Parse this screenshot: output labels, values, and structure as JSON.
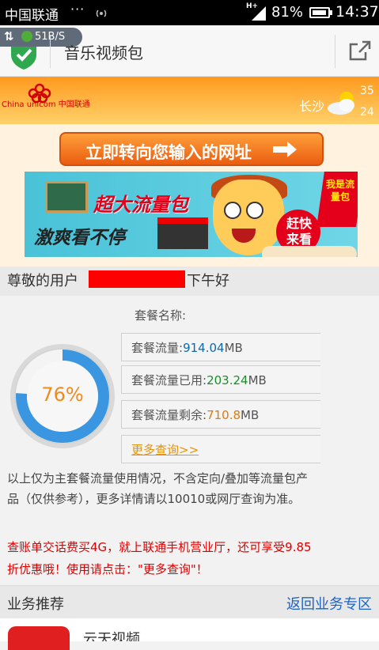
{
  "status_bar": {
    "carrier": "中国联通",
    "dots": "···",
    "network": "H+",
    "battery": "81%",
    "time": "14:37"
  },
  "title_bar": {
    "speed": "51B/S",
    "title": "音乐视频包"
  },
  "header": {
    "logo_en": "China unicom",
    "logo_cn": "中国联通",
    "city": "长沙",
    "temp_high": "35",
    "temp_low": "24"
  },
  "redirect_button": "立即转向您输入的网址",
  "ad": {
    "headline": "超大流量包",
    "subline": "激爽看不停",
    "cta": "赶快来看",
    "tag": "我是流量包"
  },
  "greeting": {
    "prefix": "尊敬的用户",
    "suffix": "下午好"
  },
  "usage": {
    "package_label": "套餐名称:",
    "percent": "76%",
    "percent_value": 0.76,
    "total_label": "套餐流量:",
    "total_value": "914.04",
    "total_unit": "MB",
    "used_label": "套餐流量已用:",
    "used_value": "203.24",
    "used_unit": "MB",
    "remaining_label": "套餐流量剩余:",
    "remaining_value": "710.8",
    "remaining_unit": "MB",
    "more_link": "更多查询>>"
  },
  "note": "以上仅为主套餐流量使用情况，不含定向/叠加等流量包产品（仅供参考），更多详情请以10010或网厅查询为准。",
  "promo": "查账单交话费买4G，就上联通手机营业厅，还可享受9.85折优惠哦！使用请点击：\"更多查询\"！",
  "recommend": {
    "title": "业务推荐",
    "back_link": "返回业务专区",
    "item": "云天视频"
  },
  "colors": {
    "orange": "#ff9a1e",
    "ring_blue": "#3a96e0",
    "link_blue": "#1a64c8",
    "promo_red": "#e10000"
  }
}
